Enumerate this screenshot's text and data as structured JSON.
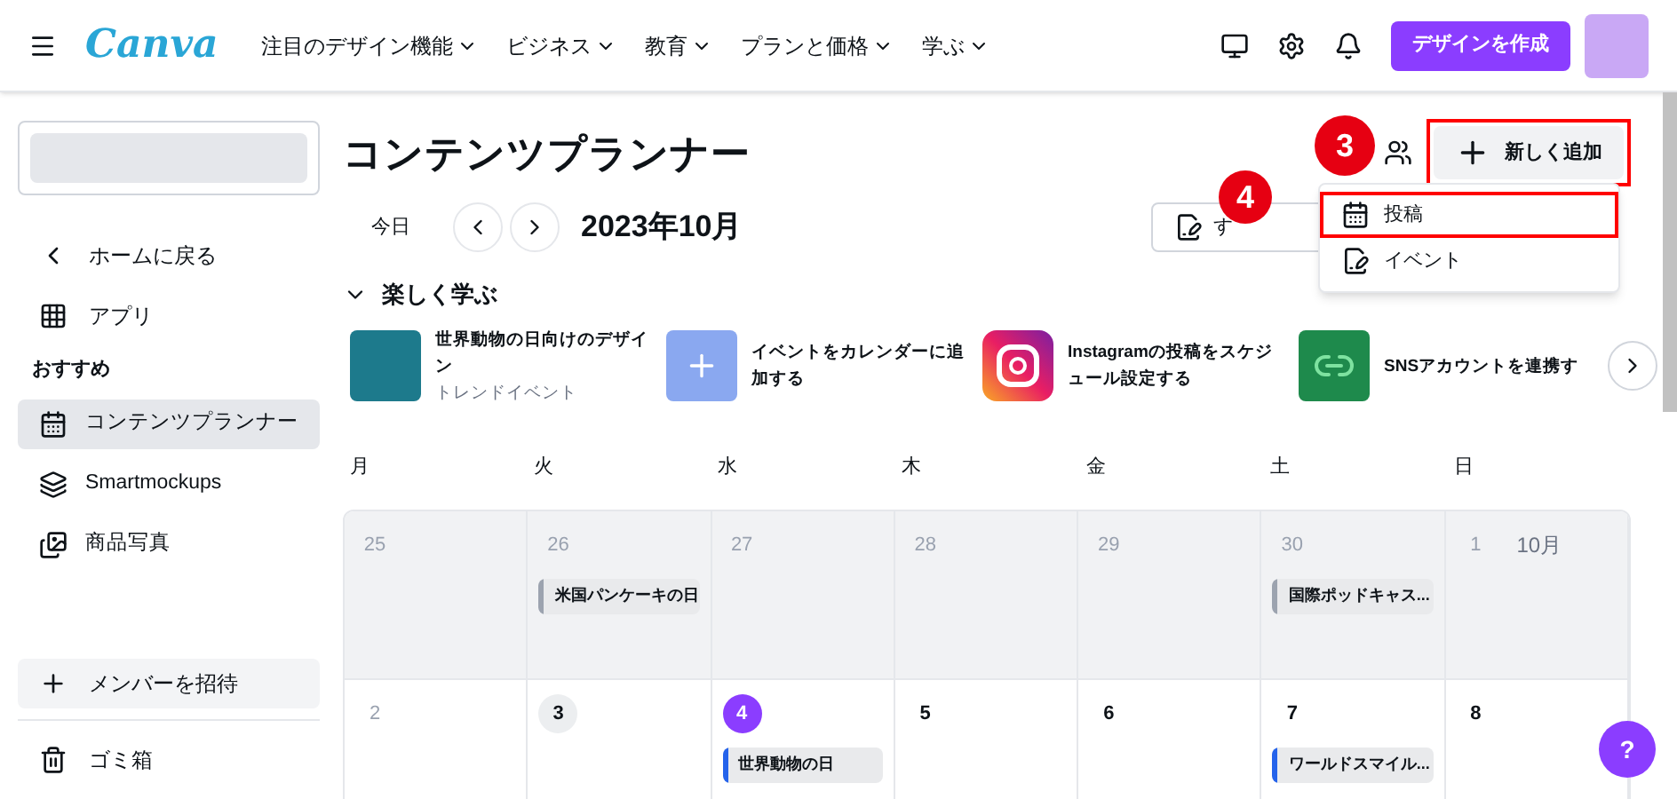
{
  "header": {
    "logo": "Canva",
    "nav": [
      {
        "label": "注目のデザイン機能"
      },
      {
        "label": "ビジネス"
      },
      {
        "label": "教育"
      },
      {
        "label": "プランと価格"
      },
      {
        "label": "学ぶ"
      }
    ],
    "create_button": "デザインを作成"
  },
  "sidebar": {
    "back": "ホームに戻る",
    "apps": "アプリ",
    "section": "おすすめ",
    "items": [
      {
        "label": "コンテンツプランナー",
        "kind": "planner",
        "selected": true
      },
      {
        "label": "Smartmockups",
        "kind": "mockups",
        "selected": false
      },
      {
        "label": "商品写真",
        "kind": "photos",
        "selected": false
      }
    ],
    "invite": "メンバーを招待",
    "trash": "ゴミ箱"
  },
  "main": {
    "title": "コンテンツプランナー",
    "today": "今日",
    "month": "2023年10月",
    "filter": "す",
    "add_button": "新しく追加",
    "menu": [
      {
        "label": "投稿",
        "kind": "post",
        "selected": true
      },
      {
        "label": "イベント",
        "kind": "event",
        "selected": false
      }
    ],
    "callouts": [
      "3",
      "4"
    ],
    "learn": {
      "title": "楽しく学ぶ",
      "expanded": true,
      "cards": [
        {
          "kind": "trend",
          "title": "世界動物の日向けのデザイン",
          "subtitle": "トレンドイベント"
        },
        {
          "kind": "calendar",
          "title": "イベントをカレンダーに追加する"
        },
        {
          "kind": "instagram",
          "title": "Instagramの投稿をスケジュール設定する"
        },
        {
          "kind": "link",
          "title": "SNSアカウントを連携す"
        }
      ]
    },
    "weekdays": [
      "月",
      "火",
      "水",
      "木",
      "金",
      "土",
      "日"
    ],
    "weeks": [
      {
        "days": [
          {
            "date": "25",
            "in_month": false,
            "today": false
          },
          {
            "date": "26",
            "in_month": false,
            "today": false,
            "events": [
              {
                "title": "米国パンケーキの日",
                "color": "#9ca3af"
              }
            ]
          },
          {
            "date": "27",
            "in_month": false,
            "today": false
          },
          {
            "date": "28",
            "in_month": false,
            "today": false
          },
          {
            "date": "29",
            "in_month": false,
            "today": false
          },
          {
            "date": "30",
            "in_month": false,
            "today": false,
            "events": [
              {
                "title": "国際ポッドキャス...",
                "color": "#9ca3af"
              }
            ]
          },
          {
            "date": "1",
            "month_label": "10月",
            "in_month": false,
            "today": false
          }
        ]
      },
      {
        "days": [
          {
            "date": "2",
            "in_month": false,
            "today": false
          },
          {
            "date": "3",
            "in_month": true,
            "today": false,
            "highlight": true
          },
          {
            "date": "4",
            "in_month": true,
            "today": true,
            "events": [
              {
                "title": "世界動物の日",
                "color": "#2563eb"
              }
            ]
          },
          {
            "date": "5",
            "in_month": true,
            "today": false
          },
          {
            "date": "6",
            "in_month": true,
            "today": false
          },
          {
            "date": "7",
            "in_month": true,
            "today": false,
            "events": [
              {
                "title": "ワールドスマイル...",
                "color": "#2563eb"
              }
            ]
          },
          {
            "date": "8",
            "in_month": true,
            "today": false
          }
        ]
      }
    ]
  },
  "help_button": "?"
}
